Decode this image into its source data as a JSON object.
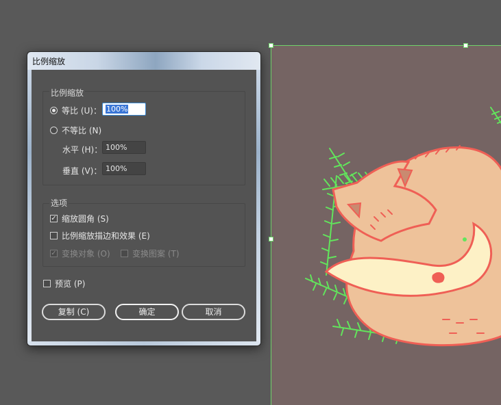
{
  "dialog": {
    "title": "比例缩放",
    "scale_group": {
      "title": "比例缩放",
      "uniform_label": "等比 (U)：",
      "uniform_value": "100%",
      "nonuniform_label": "不等比 (N)",
      "horizontal_label": "水平 (H)：",
      "horizontal_value": "100%",
      "vertical_label": "垂直 (V)：",
      "vertical_value": "100%"
    },
    "options_group": {
      "title": "选项",
      "scale_corners_label": "缩放圆角 (S)",
      "scale_strokes_label": "比例缩放描边和效果 (E)",
      "transform_objects_label": "变换对象 (O)",
      "transform_patterns_label": "变换图案 (T)"
    },
    "preview_label": "预览 (P)",
    "copy_label": "复制 (C)",
    "ok_label": "确定",
    "cancel_label": "取消"
  },
  "colors": {
    "canvas": "#595959",
    "artboard": "#756463",
    "selection": "#6fd46a",
    "fox_body": "#eec29a",
    "fox_outline": "#ef5f55",
    "pine": "#62e55c"
  }
}
